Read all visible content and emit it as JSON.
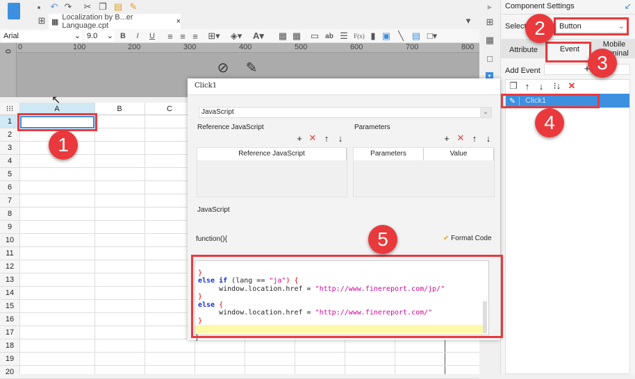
{
  "toolbar": {
    "file_tab": "Localization by B...er Language.cpt",
    "font": "Arial",
    "font_size": "9.0",
    "bold": "B",
    "italic": "I",
    "underline": "U",
    "ab": "ab",
    "formula": "F(x)"
  },
  "ruler": {
    "ticks": [
      "0",
      "100",
      "200",
      "300",
      "400",
      "500",
      "600",
      "700",
      "800"
    ],
    "vertical": "0"
  },
  "grid": {
    "columns": [
      "A",
      "B",
      "C"
    ],
    "rows": [
      "1",
      "2",
      "3",
      "4",
      "5",
      "6",
      "7",
      "8",
      "9",
      "10",
      "11",
      "12",
      "13",
      "14",
      "15",
      "16",
      "17",
      "18",
      "19",
      "20"
    ]
  },
  "dialog": {
    "title": "Click1",
    "type": "JavaScript",
    "ref_js_label": "Reference JavaScript",
    "ref_js_col": "Reference JavaScript",
    "params_label": "Parameters",
    "params_col": "Parameters",
    "value_col": "Value",
    "js_label": "JavaScript",
    "function_header": "function(){",
    "format_code": "Format Code",
    "code": {
      "l1": "}",
      "l2a": "else if",
      "l2b": " (lang == ",
      "l2c": "\"ja\"",
      "l2d": ") {",
      "l3a": "     window.location.href = ",
      "l3b": "\"http://www.finereport.com/jp/\"",
      "l4": "}",
      "l5a": "else",
      "l5b": " {",
      "l6a": "     window.location.href = ",
      "l6b": "\"http://www.finereport.com/\"",
      "l7": "}",
      "close": "}"
    }
  },
  "panel": {
    "title": "Component Settings",
    "select_label": "Select W",
    "widget": "Button",
    "tabs": [
      "Attribute",
      "Event",
      "Mobile Terminal"
    ],
    "add_event": "Add Event",
    "events": [
      "Click1"
    ]
  },
  "badges": [
    "1",
    "2",
    "3",
    "4",
    "5"
  ],
  "colors": {
    "accent": "#3d8fe0",
    "highlight": "#e9393c"
  }
}
